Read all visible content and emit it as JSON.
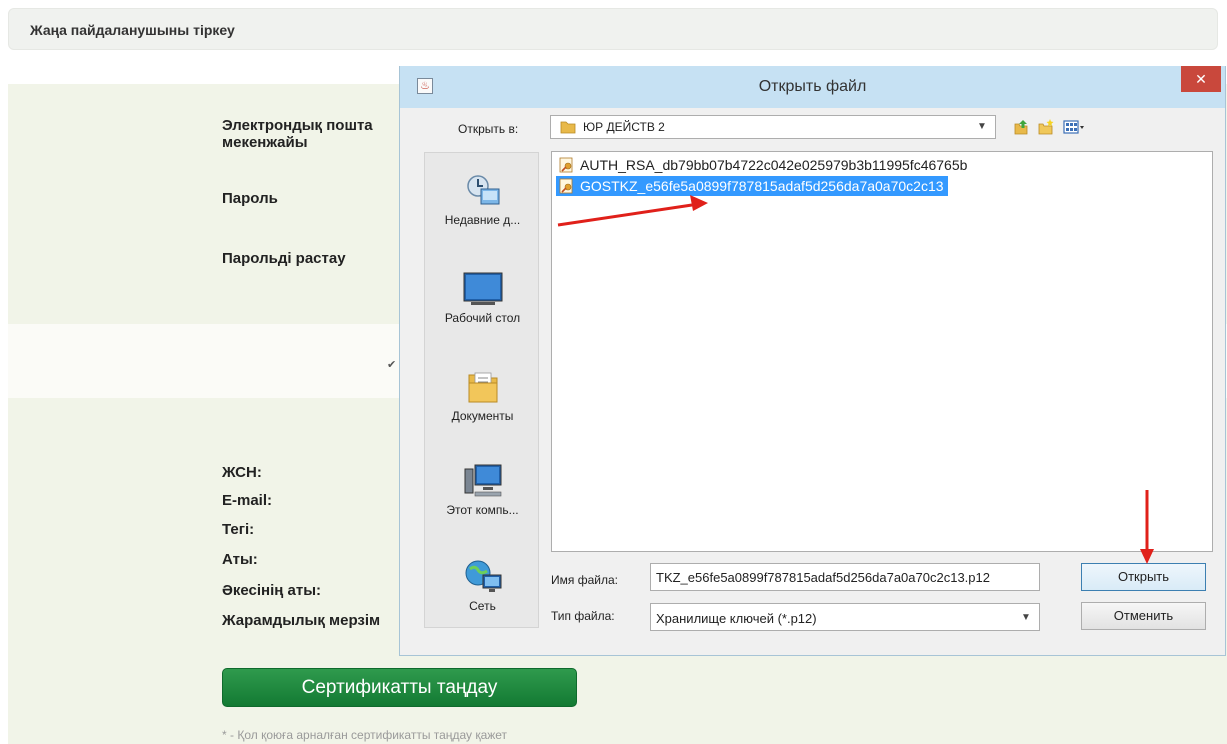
{
  "page": {
    "header_title": "Жаңа пайдаланушыны тіркеу",
    "form_labels": {
      "email": "Электрондық пошта\nмекенжайы",
      "password": "Пароль",
      "confirm_password": "Парольді растау"
    },
    "info_labels": [
      "ЖСН:",
      "E-mail:",
      "Тегі:",
      "Аты:",
      "Әкесінің аты:",
      "Жарамдылық мерзім"
    ],
    "select_certificate_button": "Сертификатты таңдау",
    "hint_text": "* - Қол қоюға арналған сертификатты таңдау қажет"
  },
  "dialog": {
    "title": "Открыть файл",
    "close_glyph": "✕",
    "look_in_label": "Открыть в:",
    "look_in_value": "ЮР ДЕЙСТВ 2",
    "places": [
      {
        "label": "Недавние д...",
        "icon": "recent-places-icon"
      },
      {
        "label": "Рабочий стол",
        "icon": "desktop-icon"
      },
      {
        "label": "Документы",
        "icon": "documents-icon"
      },
      {
        "label": "Этот компь...",
        "icon": "computer-icon"
      },
      {
        "label": "Сеть",
        "icon": "network-icon"
      }
    ],
    "files": [
      {
        "name": "AUTH_RSA_db79bb07b4722c042e025979b3b11995fc46765b",
        "selected": false
      },
      {
        "name": "GOSTKZ_e56fe5a0899f787815adaf5d256da7a0a70c2c13",
        "selected": true
      }
    ],
    "file_name_label": "Имя файла:",
    "file_name_value": "TKZ_e56fe5a0899f787815adaf5d256da7a0a70c2c13.p12",
    "file_type_label": "Тип файла:",
    "file_type_value": "Хранилище ключей (*.p12)",
    "open_button": "Открыть",
    "cancel_button": "Отменить"
  },
  "colors": {
    "selection": "#3399ff",
    "titlebar": "#c6e1f3",
    "close_button": "#c9483c",
    "green_button": "#1e8a3e",
    "annotation_arrow": "#e0201a"
  }
}
